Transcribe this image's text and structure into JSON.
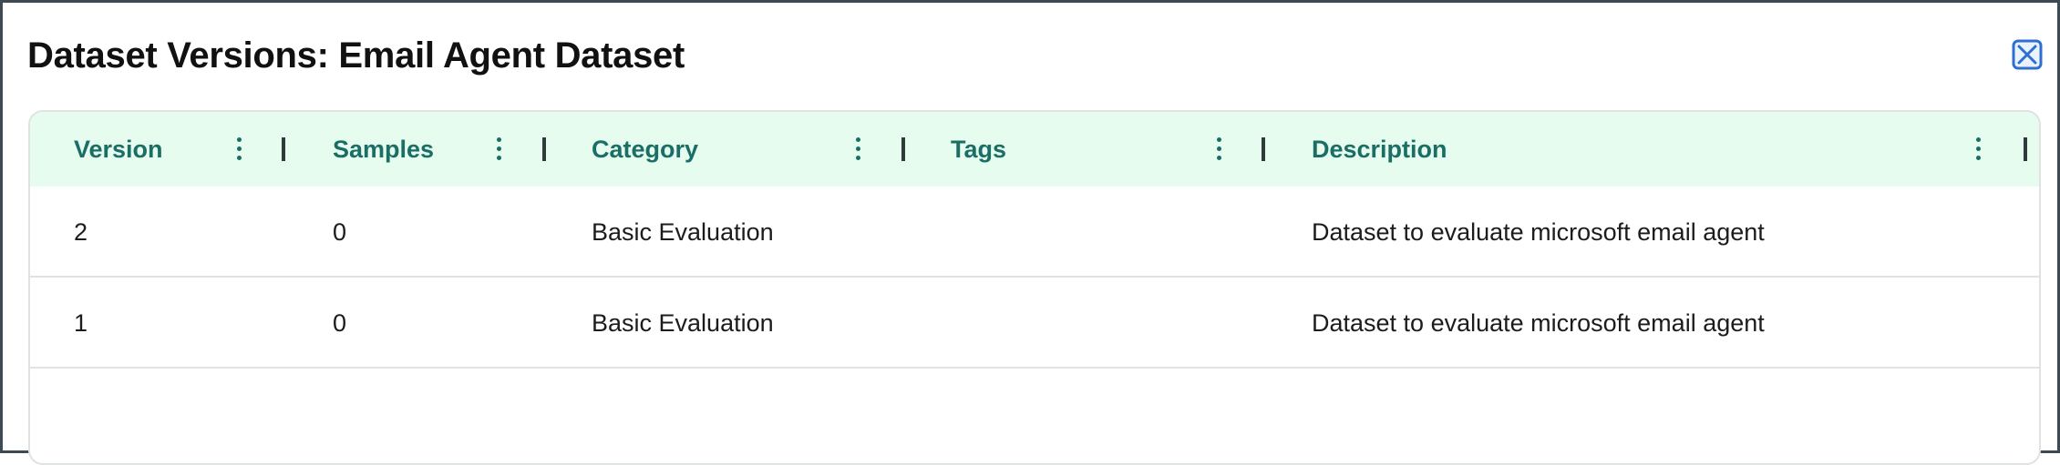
{
  "dialog": {
    "title": "Dataset Versions: Email Agent Dataset"
  },
  "table": {
    "columns": [
      {
        "key": "version",
        "label": "Version"
      },
      {
        "key": "samples",
        "label": "Samples"
      },
      {
        "key": "category",
        "label": "Category"
      },
      {
        "key": "tags",
        "label": "Tags"
      },
      {
        "key": "description",
        "label": "Description"
      }
    ],
    "rows": [
      {
        "version": "2",
        "samples": "0",
        "category": "Basic Evaluation",
        "tags": "",
        "description": "Dataset to evaluate microsoft email agent"
      },
      {
        "version": "1",
        "samples": "0",
        "category": "Basic Evaluation",
        "tags": "",
        "description": "Dataset to evaluate microsoft email agent"
      }
    ]
  },
  "colors": {
    "header_bg": "#e5fcee",
    "header_text": "#1a6e66",
    "close_icon": "#2f6fd1",
    "frame_border": "#3d4a53"
  },
  "icons": {
    "close": "close-icon",
    "column_menu": "kebab-menu-icon",
    "column_resize": "column-resize-handle"
  }
}
